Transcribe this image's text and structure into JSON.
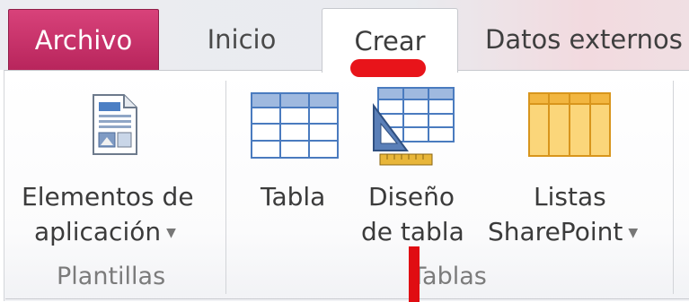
{
  "tabs": {
    "archivo": "Archivo",
    "inicio": "Inicio",
    "crear": "Crear",
    "datos_externos": "Datos externos"
  },
  "groups": {
    "plantillas": {
      "label": "Plantillas",
      "elementos": {
        "line1": "Elementos de",
        "line2": "aplicación"
      }
    },
    "tablas": {
      "label": "Tablas",
      "tabla": "Tabla",
      "diseno": {
        "line1": "Diseño",
        "line2": "de tabla"
      },
      "listas": {
        "line1": "Listas",
        "line2": "SharePoint"
      }
    }
  },
  "icons": {
    "elementos": "application-parts-icon",
    "tabla": "table-icon",
    "diseno": "table-design-icon",
    "listas": "sharepoint-list-icon",
    "dropdown": "chevron-down-icon"
  },
  "colors": {
    "archivo_tab": "#c52f69",
    "annotation_red": "#e8141a",
    "table_blue": "#4a7bbf",
    "sharepoint_orange": "#f2b640"
  }
}
